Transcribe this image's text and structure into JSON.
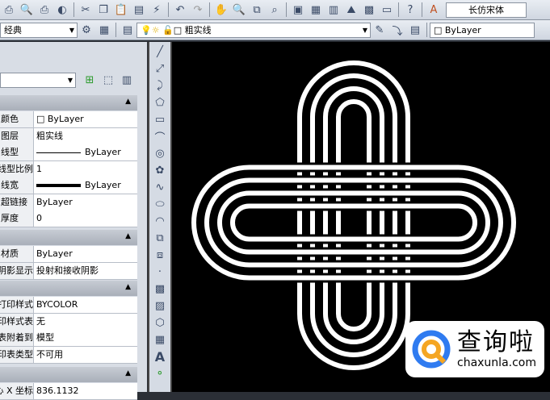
{
  "toolbar1": {
    "icons": [
      "plot-icon",
      "plot-preview-icon",
      "publish-icon",
      "3d-dwf-icon",
      "cut-icon",
      "copy-icon",
      "paste-icon",
      "match-properties-icon",
      "block-editor-icon",
      "undo-icon",
      "redo-icon",
      "pan-icon",
      "zoom-realtime-icon",
      "zoom-window-icon",
      "zoom-previous-icon",
      "properties-icon",
      "design-center-icon",
      "tool-palettes-icon",
      "sheet-set-icon",
      "markup-icon",
      "calculator-icon",
      "help-icon"
    ],
    "text_style_font": "长仿宋体"
  },
  "toolbar2": {
    "workspace": "经典",
    "layer": "粗实线",
    "color": "ByLayer"
  },
  "properties": {
    "general": [
      {
        "k": "颜色",
        "v": "ByLayer"
      },
      {
        "k": "图层",
        "v": "粗实线"
      },
      {
        "k": "线型",
        "v": "ByLayer"
      },
      {
        "k": "线型比例",
        "v": "1"
      },
      {
        "k": "线宽",
        "v": "ByLayer"
      },
      {
        "k": "超链接",
        "v": "ByLayer"
      },
      {
        "k": "厚度",
        "v": "0"
      }
    ],
    "3d": [
      {
        "k": "材质",
        "v": "ByLayer"
      },
      {
        "k": "阴影显示",
        "v": "投射和接收阴影"
      }
    ],
    "plot": [
      {
        "k": "打印样式",
        "v": "BYCOLOR"
      },
      {
        "k": "打印样式表",
        "v": "无"
      },
      {
        "k": "打印表附着到",
        "v": "模型"
      },
      {
        "k": "打印表类型",
        "v": "不可用"
      }
    ],
    "view": [
      {
        "k": "圆心 X 坐标",
        "v": "836.1132"
      }
    ]
  },
  "watermark": {
    "brand": "查询啦",
    "url": "chaxunla.com",
    "colors": {
      "blue": "#2f7bf0",
      "orange": "#f5a623"
    }
  }
}
